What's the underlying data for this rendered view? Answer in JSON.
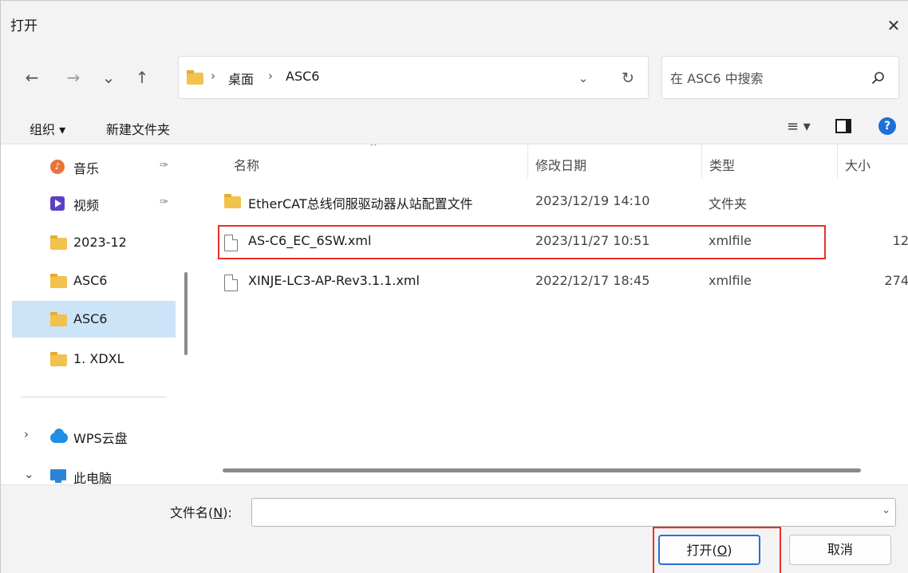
{
  "window": {
    "title": "打开",
    "close_glyph": "✕"
  },
  "nav": {
    "back_glyph": "←",
    "forward_glyph": "→",
    "recent_glyph": "⌄",
    "up_glyph": "↑",
    "breadcrumbs": [
      "桌面",
      "ASC6"
    ],
    "crumb_separator": "›",
    "dropdown_glyph": "⌄",
    "refresh_glyph": "↻",
    "search_placeholder": "在 ASC6 中搜索"
  },
  "commands": {
    "organize": "组织 ▾",
    "new_folder": "新建文件夹",
    "view_glyph": "≡ ▾",
    "help_glyph": "?"
  },
  "sidebar": {
    "items": [
      {
        "label": "音乐",
        "icon": "music-icon",
        "pinned": true
      },
      {
        "label": "视频",
        "icon": "video-icon",
        "pinned": true
      },
      {
        "label": "2023-12",
        "icon": "folder-icon"
      },
      {
        "label": "ASC6",
        "icon": "folder-icon"
      },
      {
        "label": "ASC6",
        "icon": "folder-icon",
        "selected": true
      },
      {
        "label": "1. XDXL",
        "icon": "folder-icon"
      },
      {
        "label": "WPS云盘",
        "icon": "cloud-icon",
        "chevron": "›"
      },
      {
        "label": "此电脑",
        "icon": "pc-icon",
        "chevron": "⌄"
      }
    ],
    "pin_glyph": "📌"
  },
  "filelist": {
    "columns": {
      "name": "名称",
      "date": "修改日期",
      "type": "类型",
      "size": "大小"
    },
    "sort_glyph": "^",
    "rows": [
      {
        "name": "EtherCAT总线伺服驱动器从站配置文件",
        "date": "2023/12/19 14:10",
        "type": "文件夹",
        "size": "",
        "icon": "folder-icon"
      },
      {
        "name": "AS-C6_EC_6SW.xml",
        "date": "2023/11/27 10:51",
        "type": "xmlfile",
        "size": "12",
        "icon": "file-icon",
        "highlighted": true
      },
      {
        "name": "XINJE-LC3-AP-Rev3.1.1.xml",
        "date": "2022/12/17 18:45",
        "type": "xmlfile",
        "size": "274",
        "icon": "file-icon"
      }
    ]
  },
  "bottom": {
    "filename_label": "文件名(",
    "filename_key": "N",
    "filename_label_end": "):",
    "filename_value": "",
    "dropdown_glyph": "⌄",
    "open_label": "打开(",
    "open_key": "O",
    "open_label_end": ")",
    "cancel_label": "取消"
  },
  "colors": {
    "highlight_border": "#e8302a",
    "selection_bg": "#cce4f7",
    "accent": "#2a6fd6"
  }
}
